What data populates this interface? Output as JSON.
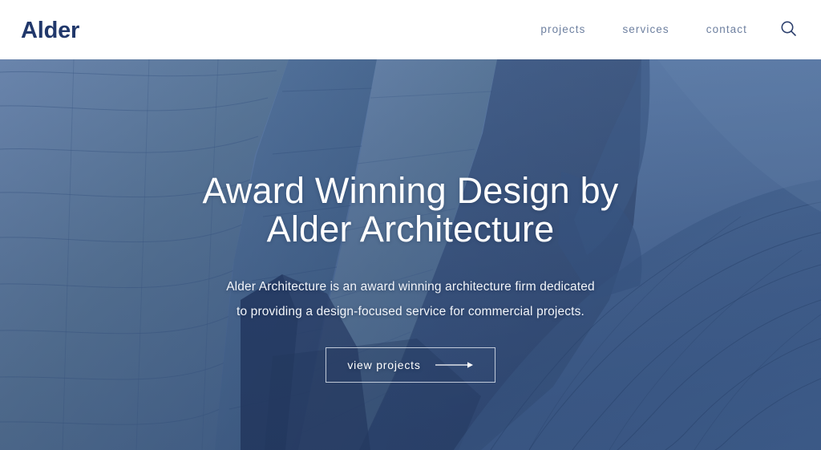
{
  "header": {
    "logo": "Alder",
    "nav": [
      {
        "label": "projects",
        "name": "nav-link-projects"
      },
      {
        "label": "services",
        "name": "nav-link-services"
      },
      {
        "label": "contact",
        "name": "nav-link-contact"
      }
    ],
    "search_icon": "search-icon"
  },
  "hero": {
    "title_line1": "Award Winning Design by",
    "title_line2": "Alder Architecture",
    "subtitle_line1": "Alder Architecture is an award winning architecture firm dedicated",
    "subtitle_line2": "to providing a design-focused service for commercial projects.",
    "cta_label": "view projects",
    "cta_icon": "arrow-right-icon",
    "image_description": "architectural photograph of curved metallic building panels against sky"
  },
  "colors": {
    "logo_navy": "#21386b",
    "nav_text": "#6e80a0",
    "header_background": "#ffffff",
    "hero_sky": "#5c7ba6",
    "hero_panel_light": "#6e8bb2",
    "hero_panel_mid": "#4e6d99",
    "hero_panel_dark": "#2a3f63",
    "hero_text": "#ffffff"
  }
}
